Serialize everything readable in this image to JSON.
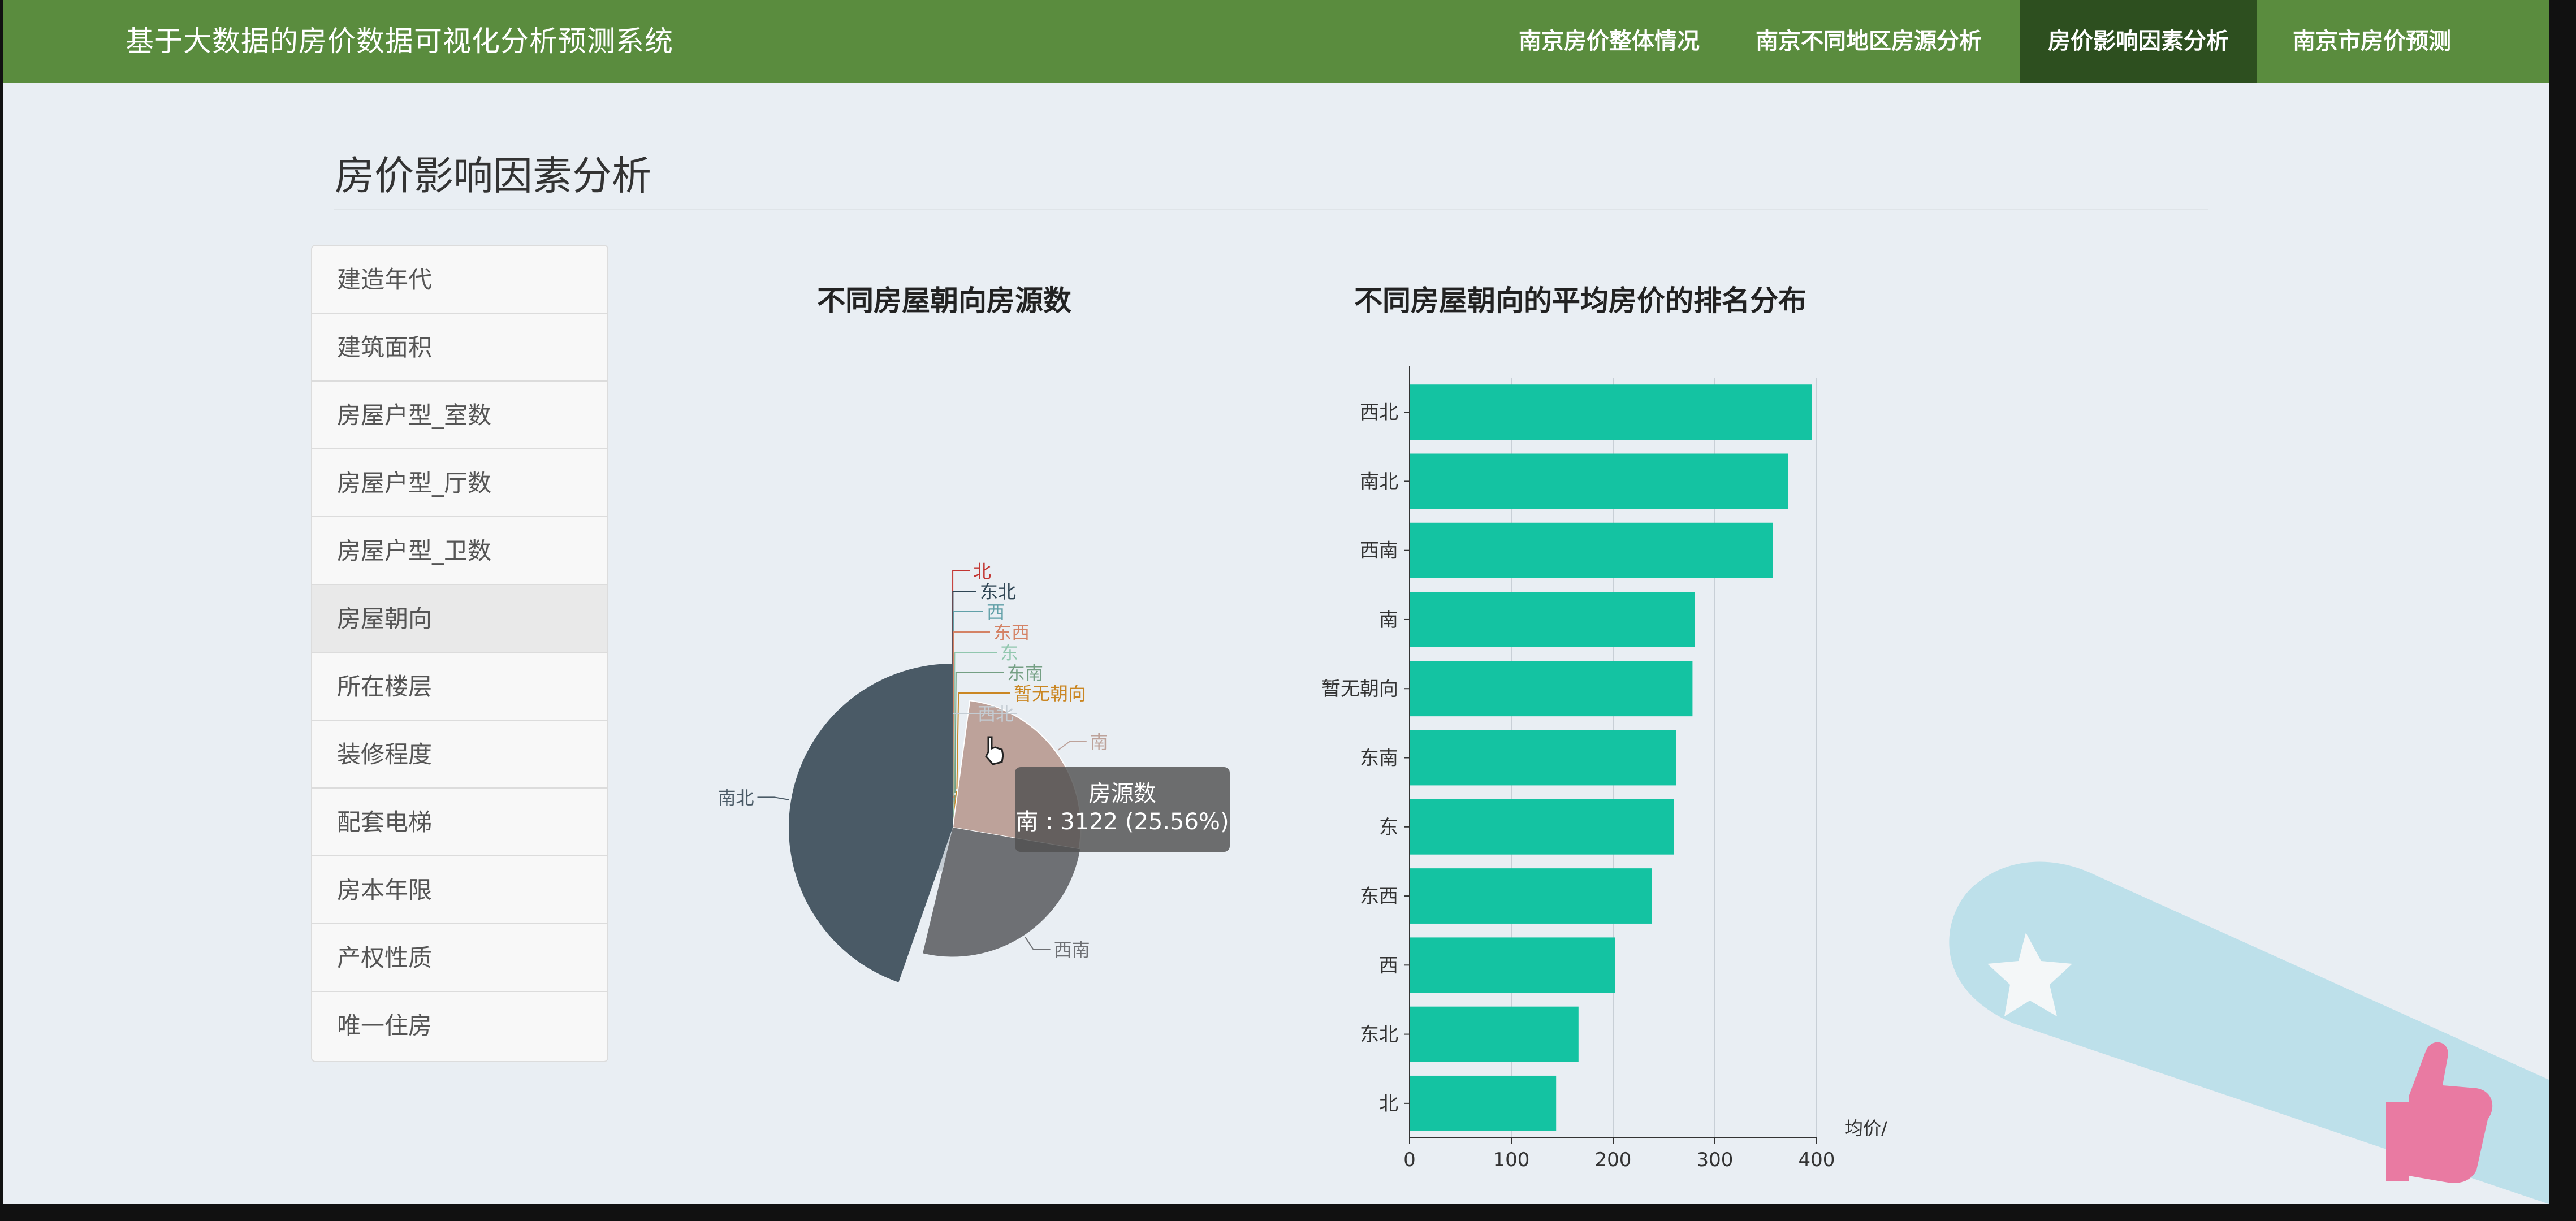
{
  "navbar": {
    "brand": "基于大数据的房价数据可视化分析预测系统",
    "items": [
      {
        "label": "南京房价整体情况",
        "active": false
      },
      {
        "label": "南京不同地区房源分析",
        "active": false
      },
      {
        "label": "房价影响因素分析",
        "active": true
      },
      {
        "label": "南京市房价预测",
        "active": false
      }
    ]
  },
  "page_title": "房价影响因素分析",
  "side_menu": {
    "items": [
      "建造年代",
      "建筑面积",
      "房屋户型_室数",
      "房屋户型_厅数",
      "房屋户型_卫数",
      "房屋朝向",
      "所在楼层",
      "装修程度",
      "配套电梯",
      "房本年限",
      "产权性质",
      "唯一住房"
    ],
    "active_index": 5
  },
  "tooltip": {
    "title": "房源数",
    "value": "南 : 3122 (25.56%)"
  },
  "colors": {
    "navbar_bg": "#5a8c3e",
    "navbar_active": "#2d4f1f",
    "bar": "#14c3a2",
    "background": "#e9eef3"
  },
  "chart_data": [
    {
      "type": "pie",
      "title": "不同房屋朝向房源数",
      "rose": true,
      "series": [
        {
          "name": "北",
          "value": 5,
          "color": "#c23531"
        },
        {
          "name": "东北",
          "value": 10,
          "color": "#2f4554"
        },
        {
          "name": "西",
          "value": 20,
          "color": "#61a0a8"
        },
        {
          "name": "东西",
          "value": 25,
          "color": "#d48265"
        },
        {
          "name": "东",
          "value": 40,
          "color": "#91c7ae"
        },
        {
          "name": "东南",
          "value": 60,
          "color": "#749f83"
        },
        {
          "name": "暂无朝向",
          "value": 100,
          "color": "#ca8622"
        },
        {
          "name": "南",
          "value": 3122,
          "color": "#bda29a"
        },
        {
          "name": "西南",
          "value": 3180,
          "color": "#6e7074"
        },
        {
          "name": "西北",
          "value": 200,
          "color": "#c4ccd3"
        },
        {
          "name": "南北",
          "value": 5454,
          "color": "#4a5a66"
        }
      ],
      "highlight": "南"
    },
    {
      "type": "bar",
      "orientation": "horizontal",
      "title": "不同房屋朝向的平均房价的排名分布",
      "categories": [
        "西北",
        "南北",
        "西南",
        "南",
        "暂无朝向",
        "东南",
        "东",
        "东西",
        "西",
        "东北",
        "北"
      ],
      "values": [
        395,
        372,
        357,
        280,
        278,
        262,
        260,
        238,
        202,
        166,
        144
      ],
      "xlabel": "均价/",
      "xlim": [
        0,
        400
      ],
      "xticks": [
        0,
        100,
        200,
        300,
        400
      ],
      "grid": true
    }
  ]
}
